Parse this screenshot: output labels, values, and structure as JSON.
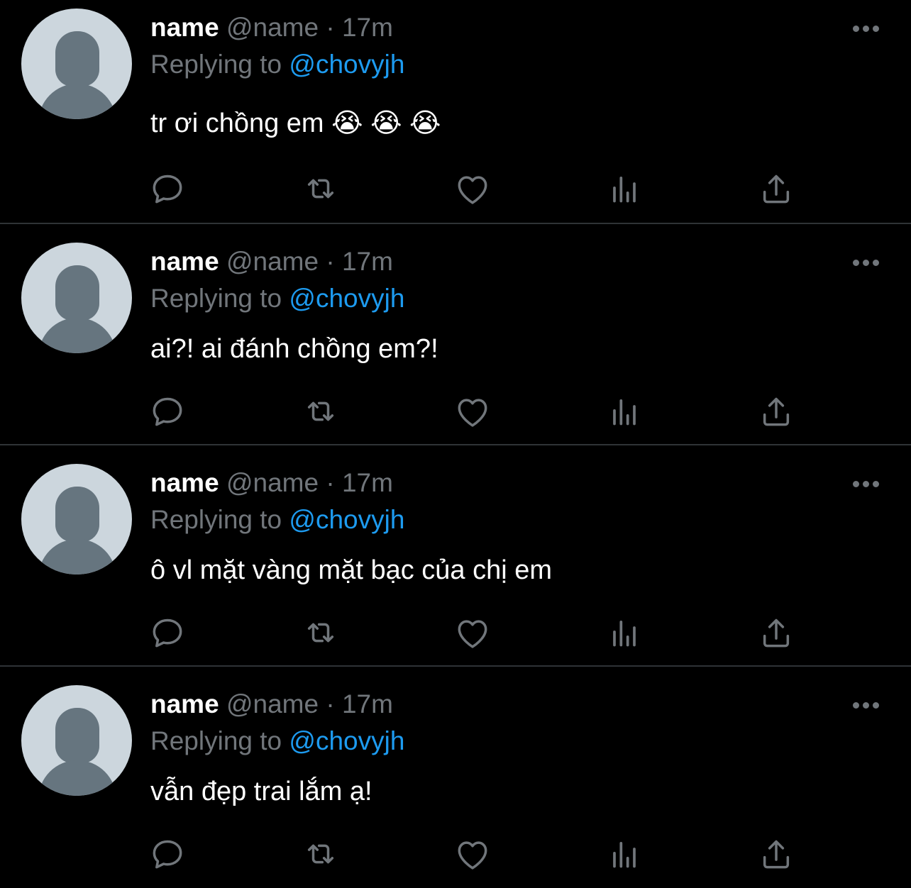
{
  "tweets": [
    {
      "author_name": "name",
      "handle": "@name",
      "separator": "·",
      "time": "17m",
      "replying_prefix": "Replying to",
      "replying_to": "@chovyjh",
      "text": "tr ơi chồng em 😭 😭 😭"
    },
    {
      "author_name": "name",
      "handle": "@name",
      "separator": "·",
      "time": "17m",
      "replying_prefix": "Replying to",
      "replying_to": "@chovyjh",
      "text": "ai?! ai đánh chồng em?!"
    },
    {
      "author_name": "name",
      "handle": "@name",
      "separator": "·",
      "time": "17m",
      "replying_prefix": "Replying to",
      "replying_to": "@chovyjh",
      "text": "ô vl mặt vàng mặt bạc của chị em"
    },
    {
      "author_name": "name",
      "handle": "@name",
      "separator": "·",
      "time": "17m",
      "replying_prefix": "Replying to",
      "replying_to": "@chovyjh",
      "text": "vẫn đẹp trai lắm ạ!"
    }
  ],
  "icons": {
    "more": "more-horizontal-icon",
    "reply": "reply-bubble-icon",
    "retweet": "retweet-icon",
    "like": "heart-icon",
    "views": "views-bar-chart-icon",
    "share": "share-upload-icon"
  },
  "colors": {
    "background": "#000000",
    "primary_text": "#ffffff",
    "secondary_text": "#71767b",
    "link": "#1d9bf0",
    "divider": "#2f3336",
    "avatar_bg": "#ccd6dd",
    "avatar_fg": "#66757f"
  }
}
